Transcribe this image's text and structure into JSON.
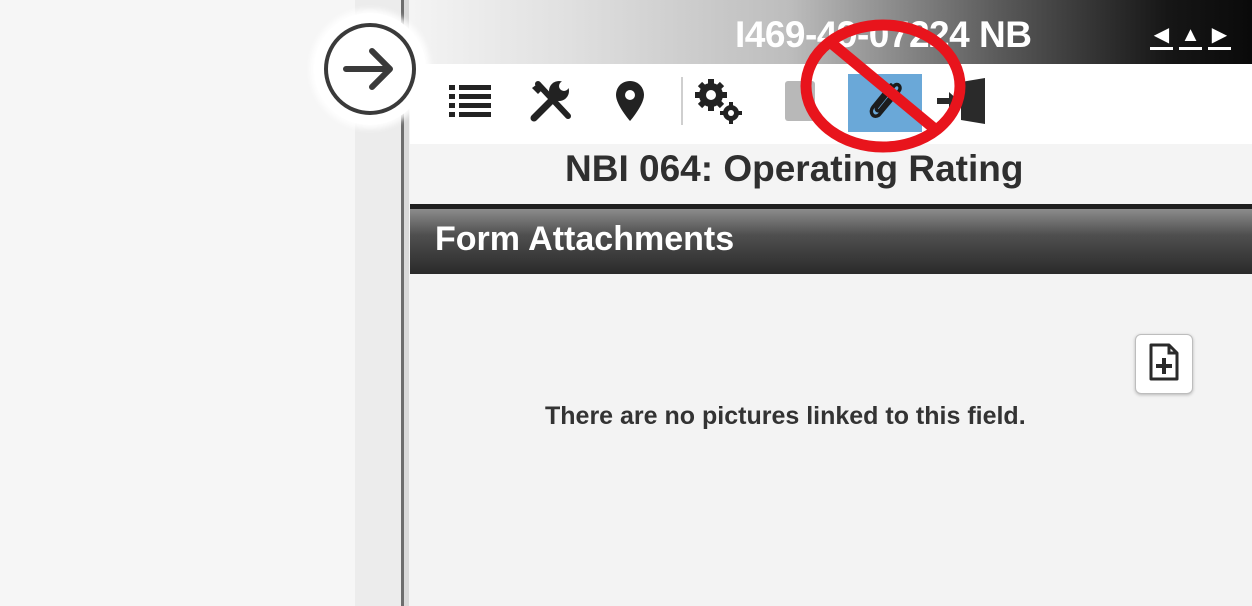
{
  "header": {
    "asset_id": "I469-49-07224 NB",
    "nav": {
      "prev": "◀",
      "up": "▲",
      "next": "▶"
    }
  },
  "toolbar": {
    "collapse_icon": "arrow-right-circle-icon",
    "tools": [
      {
        "name": "list-icon"
      },
      {
        "name": "tools-icon"
      },
      {
        "name": "map-pin-icon"
      },
      {
        "name": "gears-icon"
      },
      {
        "name": "document-icon"
      },
      {
        "name": "paperclip-icon",
        "active": true
      },
      {
        "name": "exit-door-icon"
      }
    ],
    "overlay": "prohibition-sign-icon"
  },
  "form": {
    "title": "NBI 064: Operating Rating",
    "section_title": "Form Attachments",
    "add_button_icon": "add-file-icon",
    "empty_message": "There are no pictures linked to this field."
  },
  "colors": {
    "active_tool": "#6aa8d8",
    "prohibition": "#e8141c",
    "section_bar": "#2a2a2a"
  }
}
